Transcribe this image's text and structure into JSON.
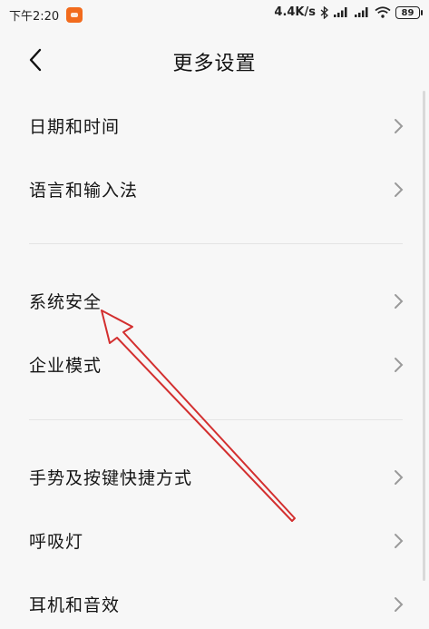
{
  "status_bar": {
    "time": "下午2:20",
    "network_speed": "4.4K/s",
    "battery": "89",
    "icons": [
      "app-notification-icon",
      "bluetooth-icon",
      "signal-icon",
      "signal-icon",
      "wifi-icon",
      "battery-icon"
    ]
  },
  "header": {
    "back_icon": "chevron-left-icon",
    "title": "更多设置"
  },
  "groups": [
    {
      "items": [
        {
          "label": "日期和时间"
        },
        {
          "label": "语言和输入法"
        }
      ]
    },
    {
      "items": [
        {
          "label": "系统安全"
        },
        {
          "label": "企业模式"
        }
      ]
    },
    {
      "items": [
        {
          "label": "手势及按键快捷方式"
        },
        {
          "label": "呼吸灯"
        },
        {
          "label": "耳机和音效"
        }
      ]
    }
  ],
  "annotation": {
    "type": "arrow",
    "color": "#d32f2f",
    "points_to": "系统安全"
  },
  "colors": {
    "background": "#f7f7f7",
    "divider": "#e4e4e4",
    "chevron": "#9a9a9a",
    "annotation": "#d32f2f"
  }
}
